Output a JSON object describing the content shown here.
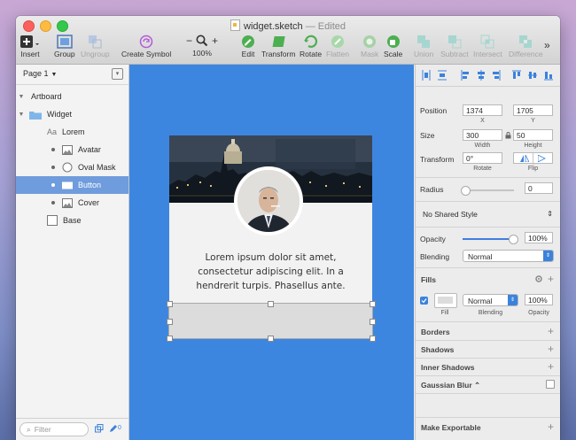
{
  "window": {
    "title": "widget.sketch",
    "status": "— Edited",
    "traffic_lights": [
      "#fc605c",
      "#fdbc40",
      "#34c84a"
    ]
  },
  "toolbar": {
    "insert": "Insert",
    "group": "Group",
    "ungroup": "Ungroup",
    "create_symbol": "Create Symbol",
    "zoom_minus": "−",
    "zoom_plus": "+",
    "zoom_value": "100%",
    "edit": "Edit",
    "transform": "Transform",
    "rotate": "Rotate",
    "flatten": "Flatten",
    "mask": "Mask",
    "scale": "Scale",
    "union": "Union",
    "subtract": "Subtract",
    "intersect": "Intersect",
    "difference": "Difference",
    "more": "»"
  },
  "sidebar": {
    "page": "Page 1",
    "artboard": "Artboard",
    "layers": [
      {
        "label": "Widget",
        "icon": "folder-icon",
        "indent": 1,
        "selected": false
      },
      {
        "label": "Lorem",
        "icon": "text-icon",
        "indent": 2,
        "selected": false
      },
      {
        "label": "Avatar",
        "icon": "image-icon",
        "indent": 2,
        "selected": false
      },
      {
        "label": "Oval Mask",
        "icon": "oval-icon",
        "indent": 2,
        "selected": false
      },
      {
        "label": "Button",
        "icon": "rectangle-icon",
        "indent": 2,
        "selected": true
      },
      {
        "label": "Cover",
        "icon": "image-icon",
        "indent": 2,
        "selected": false
      },
      {
        "label": "Base",
        "icon": "rectangle-icon",
        "indent": 1,
        "selected": false
      }
    ],
    "filter_placeholder": "Filter",
    "edited_count": "0"
  },
  "canvas": {
    "background": "#3d86e0",
    "card_text": "Lorem ipsum dolor sit amet, consectetur adipiscing elit. In a hendrerit turpis. Phasellus ante."
  },
  "inspector": {
    "position_label": "Position",
    "x_value": "1374",
    "y_value": "1705",
    "x_label": "X",
    "y_label": "Y",
    "size_label": "Size",
    "width_value": "300",
    "height_value": "50",
    "width_label": "Width",
    "height_label": "Height",
    "transform_label": "Transform",
    "rotate_value": "0°",
    "rotate_label": "Rotate",
    "flip_label": "Flip",
    "radius_label": "Radius",
    "radius_value": "0",
    "shared_style": "No Shared Style",
    "opacity_label": "Opacity",
    "opacity_value": "100%",
    "blending_label": "Blending",
    "blending_value": "Normal",
    "fills_label": "Fills",
    "fill_blend_value": "Normal",
    "fill_opacity_value": "100%",
    "fill_label": "Fill",
    "fill_blending_label": "Blending",
    "fill_opacity_label": "Opacity",
    "borders_label": "Borders",
    "shadows_label": "Shadows",
    "inner_shadows_label": "Inner Shadows",
    "gaussian_blur_label": "Gaussian Blur ⌃",
    "make_exportable_label": "Make Exportable"
  }
}
